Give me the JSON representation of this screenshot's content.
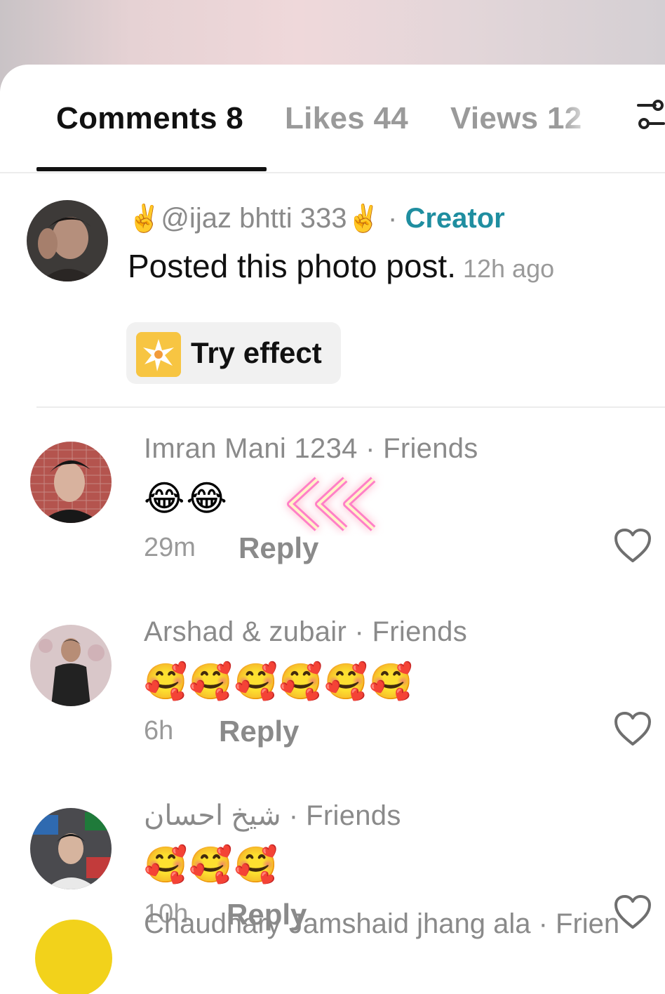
{
  "tabs": [
    {
      "label": "Comments 8",
      "active": true
    },
    {
      "label": "Likes 44",
      "active": false
    },
    {
      "label": "Views 12",
      "active": false
    }
  ],
  "creator_post": {
    "hand_emoji": "✌️",
    "username": "@ijaz bhtti 333",
    "separator": "·",
    "badge": "Creator",
    "text": "Posted this photo post.",
    "time": "12h ago",
    "effect_button": "Try effect"
  },
  "comments": [
    {
      "name": "Imran Mani 1234 · Friends",
      "content": "😂😂",
      "time": "29m",
      "reply_label": "Reply"
    },
    {
      "name": "Arshad & zubair · Friends",
      "content": "🥰🥰🥰🥰🥰🥰",
      "time": "6h",
      "reply_label": "Reply"
    },
    {
      "name": "شیخ احسان · Friends",
      "content": "🥰🥰🥰",
      "time": "10h",
      "reply_label": "Reply"
    }
  ],
  "partial_comment": {
    "name": "Chaudhary Jamshaid jhang ala · Frien"
  },
  "colors": {
    "creator_badge": "#1f8ea0",
    "active_tab": "#111111",
    "muted": "#8a8a8a"
  },
  "icons": [
    "filter-icon",
    "heart-icon",
    "sparkle-effect-icon",
    "neon-arrows-icon"
  ]
}
